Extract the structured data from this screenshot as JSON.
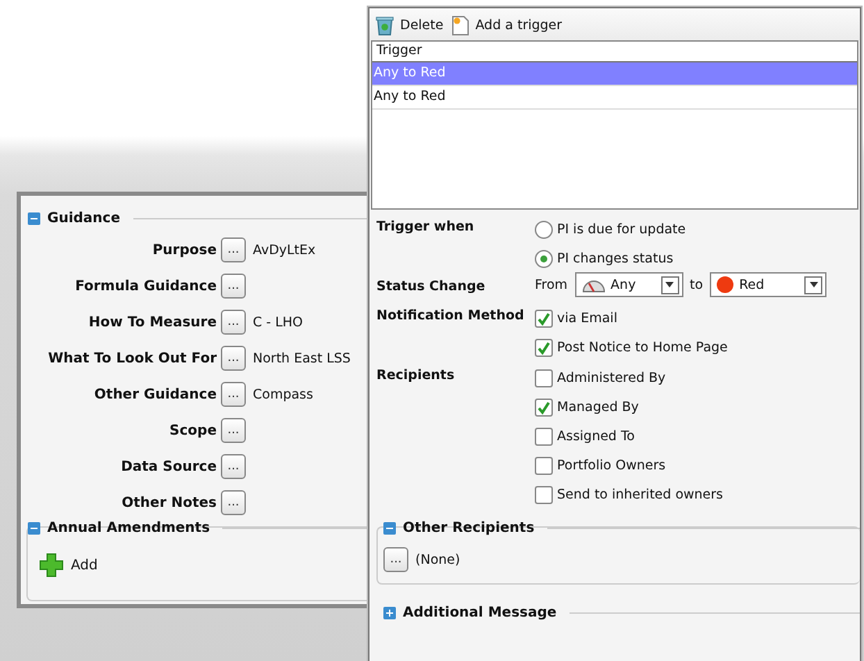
{
  "guidance": {
    "title": "Guidance",
    "expanded": true,
    "fields": [
      {
        "label": "Purpose",
        "button": "...",
        "value": "AvDyLtEx"
      },
      {
        "label": "Formula Guidance",
        "button": "..."
      },
      {
        "label": "How To Measure",
        "button": "...",
        "value": "C - LHO"
      },
      {
        "label": "What To Look Out For",
        "button": "...",
        "value": "North East LSS"
      },
      {
        "label": "Other Guidance",
        "button": "...",
        "value": "Compass"
      },
      {
        "label": "Scope",
        "button": "..."
      },
      {
        "label": "Data Source",
        "button": "..."
      },
      {
        "label": "Other Notes",
        "button": "..."
      }
    ]
  },
  "annual_amendments": {
    "title": "Annual Amendments",
    "expanded": true,
    "add_button": "Add"
  },
  "trigger_dialog": {
    "toolbar": [
      {
        "kind": "delete",
        "label": "Delete"
      },
      {
        "kind": "add",
        "label": "Add a trigger"
      }
    ],
    "trigger_list": {
      "column": "Trigger",
      "rows": [
        {
          "text": "Any to Red",
          "selected": true
        },
        {
          "text": "Any to Red",
          "selected": false
        }
      ]
    },
    "trigger_when": {
      "label": "Trigger when",
      "options": [
        {
          "label": "PI is due for update",
          "selected": false
        },
        {
          "label": "PI changes status",
          "selected": true
        }
      ]
    },
    "status_change": {
      "label": "Status Change",
      "from_label": "From",
      "from": {
        "kind": "gauge",
        "value": "Any"
      },
      "to_label": "to",
      "to": {
        "kind": "dot",
        "value": "Red",
        "color": "#ee3a10"
      }
    },
    "notification_method": {
      "label": "Notification Method",
      "options": [
        {
          "label": "via Email",
          "checked": true
        },
        {
          "label": "Post Notice to Home Page",
          "checked": true
        }
      ]
    },
    "recipients": {
      "label": "Recipients",
      "options": [
        {
          "label": "Administered By",
          "checked": false
        },
        {
          "label": "Managed By",
          "checked": true
        },
        {
          "label": "Assigned To",
          "checked": false
        },
        {
          "label": "Portfolio Owners",
          "checked": false
        },
        {
          "label": "Send to inherited owners",
          "checked": false
        }
      ]
    },
    "other_recipients": {
      "title": "Other Recipients",
      "expanded": true,
      "button": "...",
      "value": "(None)"
    },
    "additional_message": {
      "title": "Additional Message",
      "expanded": false
    }
  }
}
